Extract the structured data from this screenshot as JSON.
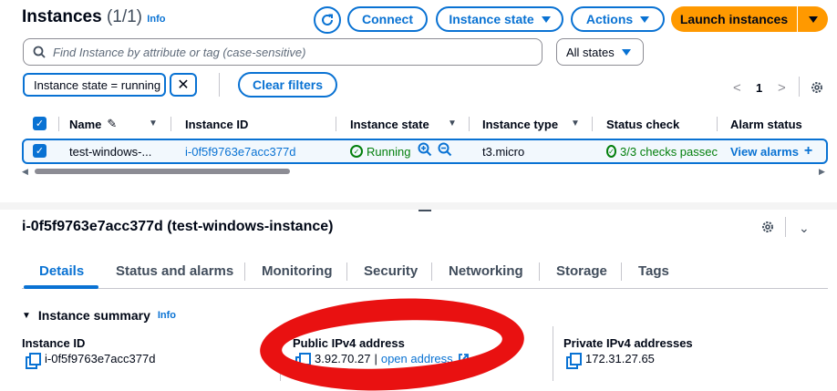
{
  "header": {
    "title": "Instances",
    "count": "(1/1)",
    "info": "Info",
    "buttons": {
      "connect": "Connect",
      "instance_state": "Instance state",
      "actions": "Actions",
      "launch": "Launch instances"
    }
  },
  "search": {
    "placeholder": "Find Instance by attribute or tag (case-sensitive)",
    "state_filter": "All states"
  },
  "filter": {
    "chip": "Instance state = running",
    "clear": "Clear filters"
  },
  "pagination": {
    "prev": "<",
    "page": "1",
    "next": ">"
  },
  "table": {
    "headers": [
      "Name",
      "Instance ID",
      "Instance state",
      "Instance type",
      "Status check",
      "Alarm status"
    ],
    "row": {
      "name": "test-windows-...",
      "instance_id": "i-0f5f9763e7acc377d",
      "state": "Running",
      "type": "t3.micro",
      "status_check": "3/3 checks passec",
      "alarm": "View alarms"
    }
  },
  "details": {
    "heading": "i-0f5f9763e7acc377d (test-windows-instance)",
    "tabs": [
      "Details",
      "Status and alarms",
      "Monitoring",
      "Security",
      "Networking",
      "Storage",
      "Tags"
    ],
    "section_title": "Instance summary",
    "section_info": "Info",
    "instance_id_label": "Instance ID",
    "instance_id_value": "i-0f5f9763e7acc377d",
    "public_ip_label": "Public IPv4 address",
    "public_ip_value": "3.92.70.27",
    "separator": "|",
    "open_address": "open address",
    "private_ip_label": "Private IPv4 addresses",
    "private_ip_value": "172.31.27.65"
  },
  "colors": {
    "accent": "#0972d3",
    "primary_button": "#ff9900",
    "running": "#037f0c",
    "annotation": "#e91111"
  }
}
